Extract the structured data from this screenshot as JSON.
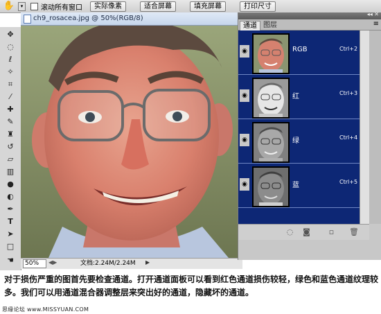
{
  "options_bar": {
    "scroll_all_windows": "滚动所有窗口",
    "buttons": [
      "实际像素",
      "适合屏幕",
      "填充屏幕",
      "打印尺寸"
    ]
  },
  "toolbox": {
    "tools": [
      "move-icon",
      "marquee-icon",
      "lasso-icon",
      "magic-wand-icon",
      "crop-icon",
      "eyedropper-icon",
      "healing-brush-icon",
      "brush-icon",
      "clone-stamp-icon",
      "history-brush-icon",
      "eraser-icon",
      "gradient-icon",
      "blur-icon",
      "dodge-icon",
      "pen-icon",
      "type-icon",
      "path-select-icon",
      "shape-icon",
      "hand-icon"
    ]
  },
  "document": {
    "title": "ch9_rosacea.jpg @ 50%(RGB/8)",
    "zoom": "50%",
    "doc_size": "文档:2.24M/2.24M"
  },
  "channels_panel": {
    "tabs": [
      "通道",
      "图层"
    ],
    "channels": [
      {
        "name": "RGB",
        "shortcut": "Ctrl+2",
        "thumb": "color"
      },
      {
        "name": "红",
        "shortcut": "Ctrl+3",
        "thumb": "light"
      },
      {
        "name": "绿",
        "shortcut": "Ctrl+4",
        "thumb": "mid"
      },
      {
        "name": "蓝",
        "shortcut": "Ctrl+5",
        "thumb": "dark"
      }
    ]
  },
  "caption": {
    "text": "对于损伤严重的图首先要检查通道。打开通道面板可以看到红色通道损伤较轻，绿色和蓝色通道纹理较多。我们可以用通道混合器调整层来突出好的通道，隐藏坏的通道。",
    "watermark": "思缘论坛 www.MISSYUAN.COM"
  },
  "colors": {
    "channel_list_bg": "#0d2775",
    "canvas_backdrop": "#7f8b63",
    "skin": "#d98a7a"
  }
}
